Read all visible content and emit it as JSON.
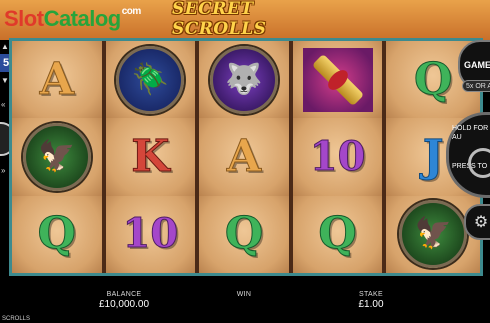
{
  "watermark": {
    "part1": "Slot",
    "part2": "Catalog",
    "part3": "com"
  },
  "game_logo": "SECRET SCROLLS",
  "left_panel": {
    "bet_lines": "5"
  },
  "reels": [
    [
      {
        "type": "letter",
        "symbol": "A",
        "cls": "A"
      },
      {
        "type": "coin",
        "symbol": "bird",
        "icon": "bird-icon"
      },
      {
        "type": "letter",
        "symbol": "Q",
        "cls": "Q"
      }
    ],
    [
      {
        "type": "coin",
        "symbol": "scarab",
        "icon": "scarab-icon"
      },
      {
        "type": "letter",
        "symbol": "K",
        "cls": "K"
      },
      {
        "type": "letter",
        "symbol": "10",
        "cls": "ten"
      }
    ],
    [
      {
        "type": "coin",
        "symbol": "anubis",
        "icon": "anubis-icon"
      },
      {
        "type": "letter",
        "symbol": "A",
        "cls": "A"
      },
      {
        "type": "letter",
        "symbol": "Q",
        "cls": "Q"
      }
    ],
    [
      {
        "type": "scroll",
        "symbol": "scroll",
        "icon": "scroll-icon"
      },
      {
        "type": "letter",
        "symbol": "10",
        "cls": "ten"
      },
      {
        "type": "letter",
        "symbol": "Q",
        "cls": "Q"
      }
    ],
    [
      {
        "type": "letter",
        "symbol": "Q",
        "cls": "Q"
      },
      {
        "type": "letter",
        "symbol": "J",
        "cls": "J"
      },
      {
        "type": "coin",
        "symbol": "bird",
        "icon": "bird-icon"
      }
    ]
  ],
  "right_panel": {
    "game_button": "GAME",
    "auto_chip": "5x OR AR",
    "spin_hint_line1": "HOLD FOR AU",
    "spin_hint_line2": "PRESS TO"
  },
  "bottom": {
    "balance_label": "BALANCE",
    "balance_value": "£10,000.00",
    "win_label": "WIN",
    "win_value": "",
    "stake_label": "STAKE",
    "stake_value": "£1.00",
    "game_name": "SCROLLS"
  },
  "colors": {
    "frame": "#3d8a8e",
    "reel_bg": "#d7a36b",
    "separator": "#4b2a17"
  }
}
